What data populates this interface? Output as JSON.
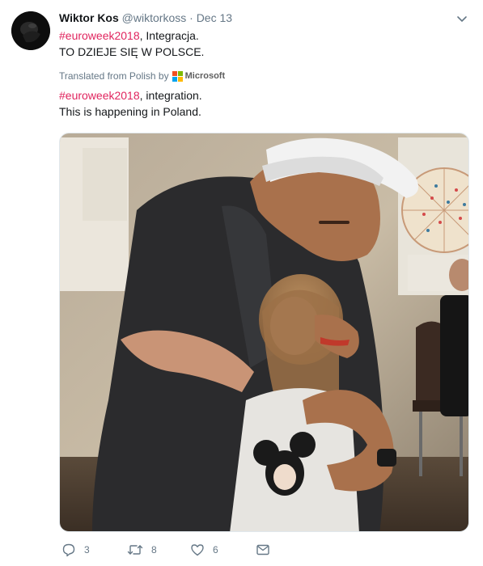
{
  "author": {
    "name": "Wiktor Kos",
    "handle": "@wiktorkoss",
    "separator": "·",
    "date": "Dec 13"
  },
  "tweet": {
    "hashtag": "#euroweek2018",
    "line1_rest": ", Integracja.",
    "line2": "TO DZIEJE SIĘ W POLSCE."
  },
  "translation": {
    "label": "Translated from Polish by",
    "provider": "Microsoft",
    "hashtag": "#euroweek2018",
    "line1_rest": ", integration.",
    "line2": "This is happening in Poland."
  },
  "actions": {
    "replies": "3",
    "retweets": "8",
    "likes": "6"
  },
  "icons": {
    "reply": "reply-icon",
    "retweet": "retweet-icon",
    "like": "heart-icon",
    "dm": "envelope-icon",
    "more": "chevron-down-icon"
  },
  "colors": {
    "hashtag": "#e0245e",
    "secondary": "#657786",
    "ms_red": "#f25022",
    "ms_green": "#7fba00",
    "ms_blue": "#00a4ef",
    "ms_yellow": "#ffb900"
  }
}
